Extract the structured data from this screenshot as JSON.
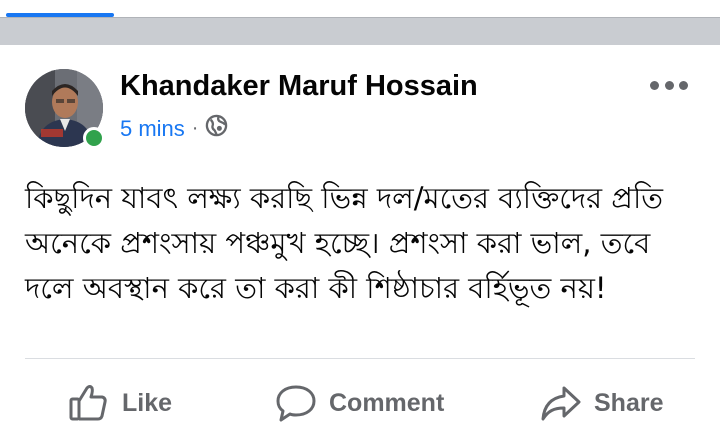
{
  "post": {
    "author": "Khandaker Maruf Hossain",
    "timestamp": "5 mins",
    "separator": "·",
    "audience_icon": "globe-icon",
    "text": "কিছুদিন যাবৎ লক্ষ্য করছি ভিন্ন দল/মতের ব্যক্তিদের প্রতি অনেকে প্রশংসায় পঞ্চমুখ হচ্ছে। প্রশংসা করা ভাল, তবে দলে অবস্থান করে তা করা কী শিষ্ঠাচার বর্হিভূত নয়!"
  },
  "actions": {
    "like_label": "Like",
    "comment_label": "Comment",
    "share_label": "Share"
  },
  "colors": {
    "accent": "#1877f2",
    "online": "#31a24c",
    "secondary_text": "#65676b"
  }
}
